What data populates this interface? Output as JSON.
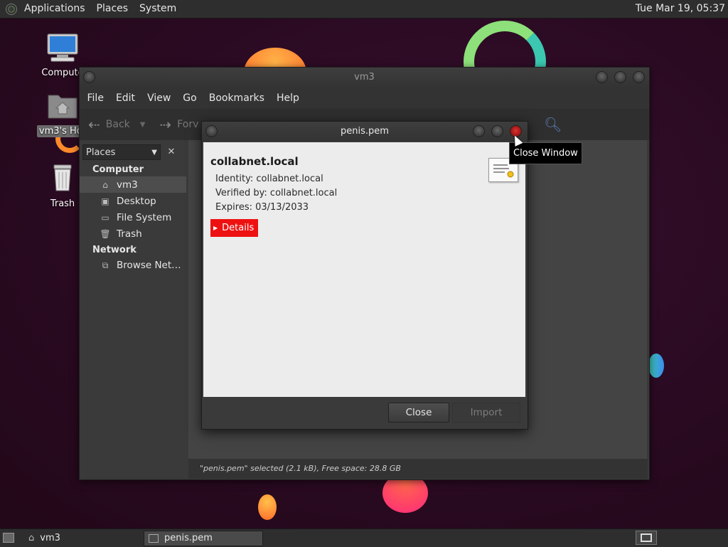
{
  "top_panel": {
    "menus": [
      "Applications",
      "Places",
      "System"
    ],
    "clock": "Tue Mar 19, 05:37"
  },
  "desktop": {
    "icons": [
      {
        "label": "Compute",
        "icon": "computer-icon"
      },
      {
        "label": "vm3's Hor",
        "icon": "home-folder-icon"
      },
      {
        "label": "Trash",
        "icon": "trash-icon"
      }
    ]
  },
  "file_manager": {
    "title": "vm3",
    "menu": [
      "File",
      "Edit",
      "View",
      "Go",
      "Bookmarks",
      "Help"
    ],
    "toolbar": {
      "back": "Back",
      "forward": "Forv"
    },
    "sidebar": {
      "combo": "Places",
      "sections": [
        {
          "title": "Computer",
          "items": [
            {
              "label": "vm3",
              "icon": "home-icon",
              "selected": true
            },
            {
              "label": "Desktop",
              "icon": "desktop-icon"
            },
            {
              "label": "File System",
              "icon": "drive-icon"
            },
            {
              "label": "Trash",
              "icon": "trash-icon"
            }
          ]
        },
        {
          "title": "Network",
          "items": [
            {
              "label": "Browse Net…",
              "icon": "network-icon"
            }
          ]
        }
      ]
    },
    "statusbar": "\"penis.pem\" selected (2.1 kB), Free space: 28.8 GB"
  },
  "cert_dialog": {
    "title": "penis.pem",
    "cert_name": "collabnet.local",
    "identity": "Identity: collabnet.local",
    "verified_by": "Verified by: collabnet.local",
    "expires": "Expires: 03/13/2033",
    "details_label": "Details",
    "close_label": "Close",
    "import_label": "Import"
  },
  "tooltip": "Close Window",
  "taskbar": {
    "tasks": [
      {
        "label": "vm3",
        "active": false
      },
      {
        "label": "penis.pem",
        "active": true
      }
    ]
  },
  "colors": {
    "details_highlight": "#ee1111",
    "close_button_red": "#cc2222"
  }
}
